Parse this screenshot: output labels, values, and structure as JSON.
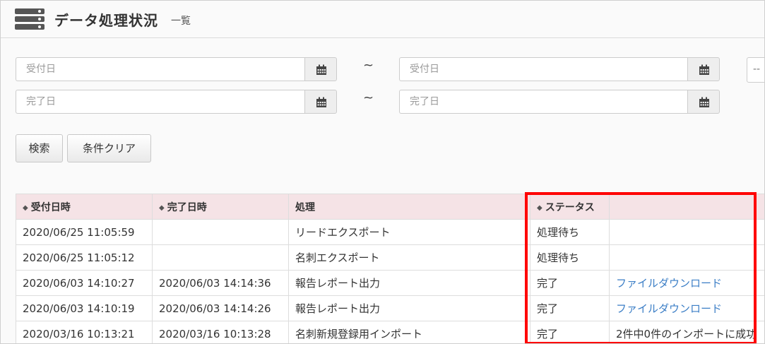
{
  "header": {
    "title": "データ処理状況",
    "subtitle": "一覧",
    "icon": "database-icon"
  },
  "filters": {
    "received_from_placeholder": "受付日",
    "received_to_placeholder": "受付日",
    "completed_from_placeholder": "完了日",
    "completed_to_placeholder": "完了日",
    "range_separator": "~",
    "extra_select_value": "--",
    "calendar_icon": "calendar-icon"
  },
  "buttons": {
    "search_label": "検索",
    "clear_label": "条件クリア"
  },
  "table": {
    "columns": [
      "受付日時",
      "完了日時",
      "処理",
      "ステータス",
      ""
    ],
    "rows": [
      [
        "2020/06/25 11:05:59",
        "",
        "リードエクスポート",
        "処理待ち",
        ""
      ],
      [
        "2020/06/25 11:05:12",
        "",
        "名刺エクスポート",
        "処理待ち",
        ""
      ],
      [
        "2020/06/03 14:10:27",
        "2020/06/03 14:14:36",
        "報告レポート出力",
        "完了",
        "ファイルダウンロード"
      ],
      [
        "2020/06/03 14:10:19",
        "2020/06/03 14:14:26",
        "報告レポート出力",
        "完了",
        "ファイルダウンロード"
      ],
      [
        "2020/03/16 10:13:21",
        "2020/03/16 10:13:28",
        "名刺新規登録用インポート",
        "完了",
        "2件中0件のインポートに成功"
      ]
    ]
  },
  "colors": {
    "header_row_bg": "#f5e3e6",
    "link": "#3b7ec6",
    "highlight": "#ff0000"
  }
}
